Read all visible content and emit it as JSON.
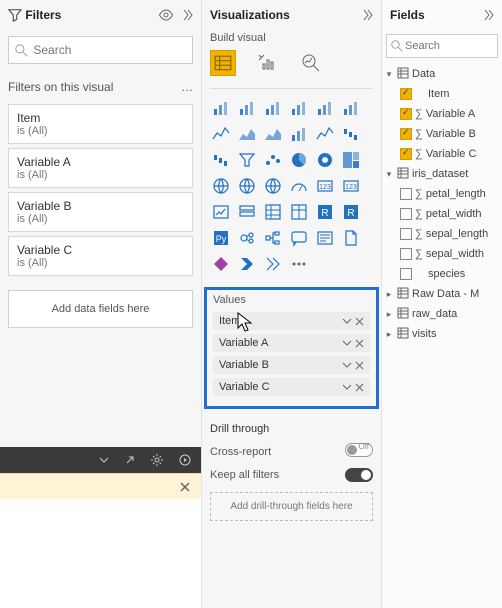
{
  "filters": {
    "title": "Filters",
    "search_placeholder": "Search",
    "section_label": "Filters on this visual",
    "cards": [
      {
        "name": "Item",
        "value": "is (All)"
      },
      {
        "name": "Variable A",
        "value": "is (All)"
      },
      {
        "name": "Variable B",
        "value": "is (All)"
      },
      {
        "name": "Variable C",
        "value": "is (All)"
      }
    ],
    "drop_hint": "Add data fields here"
  },
  "viz": {
    "title": "Visualizations",
    "build_label": "Build visual",
    "values_title": "Values",
    "value_fields": [
      "Item",
      "Variable A",
      "Variable B",
      "Variable C"
    ],
    "drill": {
      "title": "Drill through",
      "cross_label": "Cross-report",
      "cross_on": false,
      "keep_label": "Keep all filters",
      "keep_on": true,
      "drop_hint": "Add drill-through fields here"
    },
    "gallery_icons": [
      "stacked-bar",
      "stacked-column",
      "clustered-bar",
      "clustered-column",
      "100-stacked-bar",
      "100-stacked-column",
      "line",
      "area",
      "stacked-area",
      "line-column",
      "line-clustered",
      "ribbon",
      "waterfall",
      "funnel",
      "scatter",
      "pie",
      "donut",
      "treemap",
      "map",
      "filled-map",
      "azure-map",
      "gauge",
      "card",
      "multi-row-card",
      "kpi",
      "slicer",
      "table",
      "matrix",
      "r-visual",
      "r-script",
      "python",
      "key-influencers",
      "decomposition-tree",
      "qna",
      "narrative",
      "paginated",
      "powerapps",
      "powerautomate",
      "get-more",
      "ellipsis"
    ]
  },
  "fields": {
    "title": "Fields",
    "search_placeholder": "Search",
    "tables": [
      {
        "name": "Data",
        "expanded": true,
        "columns": [
          {
            "name": "Item",
            "checked": true,
            "type": "text"
          },
          {
            "name": "Variable A",
            "checked": true,
            "type": "sum"
          },
          {
            "name": "Variable B",
            "checked": true,
            "type": "sum"
          },
          {
            "name": "Variable C",
            "checked": true,
            "type": "sum"
          }
        ]
      },
      {
        "name": "iris_dataset",
        "expanded": true,
        "columns": [
          {
            "name": "petal_length",
            "checked": false,
            "type": "sum"
          },
          {
            "name": "petal_width",
            "checked": false,
            "type": "sum"
          },
          {
            "name": "sepal_length",
            "checked": false,
            "type": "sum"
          },
          {
            "name": "sepal_width",
            "checked": false,
            "type": "sum"
          },
          {
            "name": "species",
            "checked": false,
            "type": "text"
          }
        ]
      },
      {
        "name": "Raw Data - M",
        "expanded": false
      },
      {
        "name": "raw_data",
        "expanded": false
      },
      {
        "name": "visits",
        "expanded": false
      }
    ]
  },
  "toggle_off_label": "Off"
}
